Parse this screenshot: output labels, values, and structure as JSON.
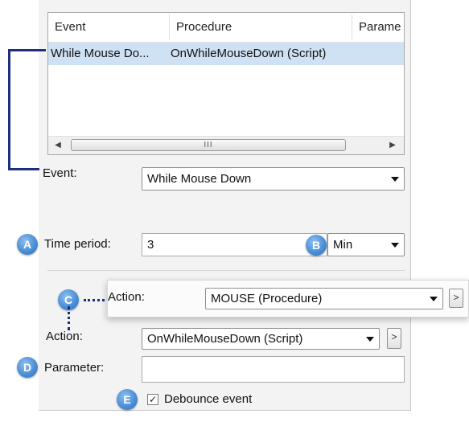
{
  "event_list": {
    "columns": [
      "Event",
      "Procedure",
      "Parame"
    ],
    "rows": [
      {
        "event": "While Mouse Do...",
        "procedure": "OnWhileMouseDown (Script)",
        "parameter": ""
      }
    ],
    "scrollbar_grip": "III"
  },
  "form": {
    "event_label": "Event:",
    "event_value": "While Mouse Down",
    "time_period_label": "Time period:",
    "time_period_value": "3",
    "time_unit_value": "Min",
    "overlay_action_label": "Action:",
    "overlay_action_value": "MOUSE (Procedure)",
    "action_label": "Action:",
    "action_value": "OnWhileMouseDown (Script)",
    "browse_button": ">",
    "parameter_label": "Parameter:",
    "parameter_value": "",
    "debounce_label": "Debounce event",
    "debounce_checked": true,
    "check_mark": "✓"
  },
  "callouts": {
    "a": "A",
    "b": "B",
    "c": "C",
    "d": "D",
    "e": "E"
  },
  "colors": {
    "accent": "#1f2f80",
    "selection": "#cfe2f3",
    "badge": "#4c8fd6"
  }
}
